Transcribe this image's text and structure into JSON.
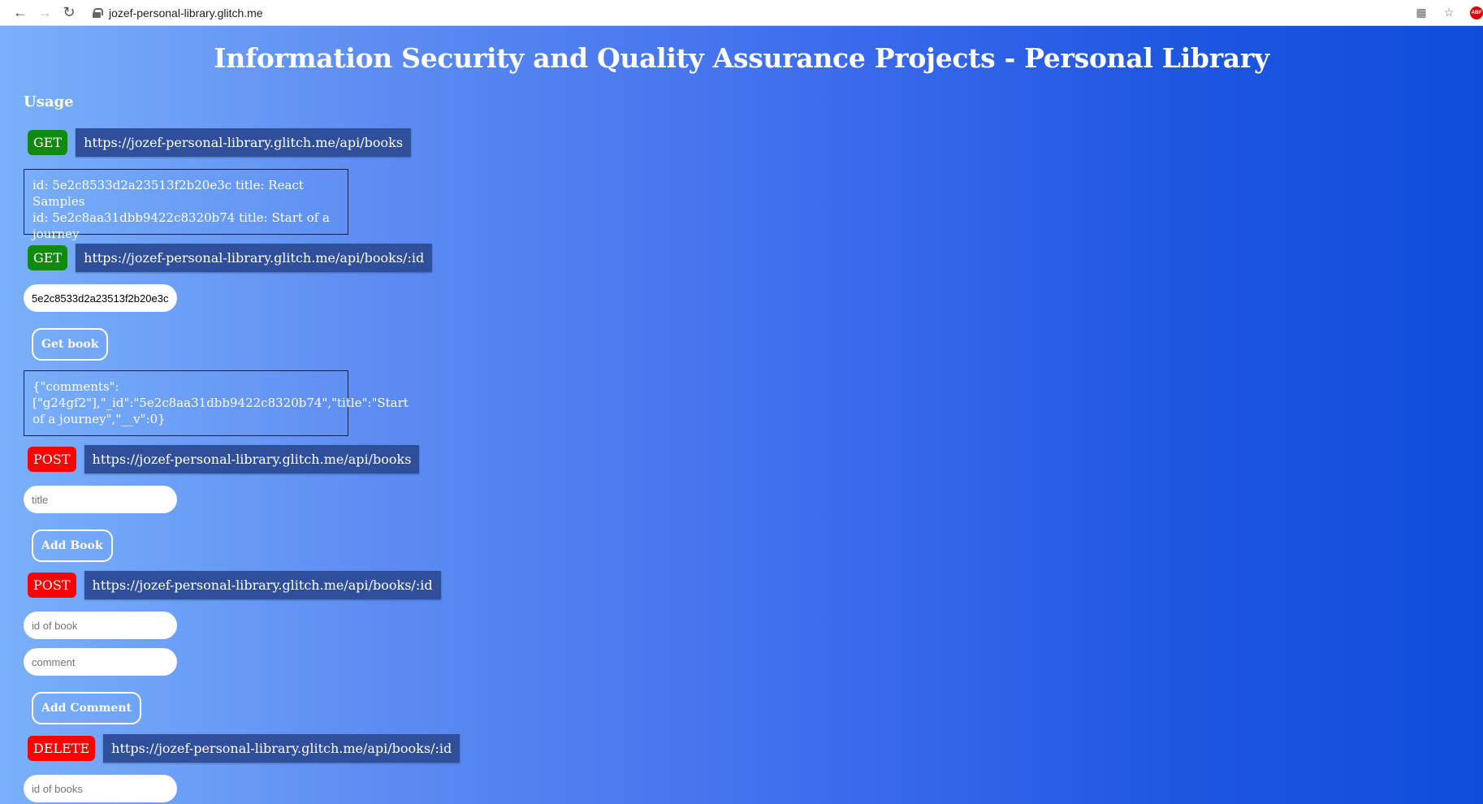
{
  "browser": {
    "url": "jozef-personal-library.glitch.me",
    "extension_badge": "ABP"
  },
  "page": {
    "title": "Information Security and Quality Assurance Projects - Personal Library",
    "usage_heading": "Usage"
  },
  "endpoints": {
    "get_books": {
      "method": "GET",
      "url": "https://jozef-personal-library.glitch.me/api/books"
    },
    "get_book": {
      "method": "GET",
      "url": "https://jozef-personal-library.glitch.me/api/books/:id"
    },
    "post_book": {
      "method": "POST",
      "url": "https://jozef-personal-library.glitch.me/api/books"
    },
    "post_comment": {
      "method": "POST",
      "url": "https://jozef-personal-library.glitch.me/api/books/:id"
    },
    "delete_book": {
      "method": "DELETE",
      "url": "https://jozef-personal-library.glitch.me/api/books/:id"
    }
  },
  "books_output": {
    "line1": "id: 5e2c8533d2a23513f2b20e3c title: React Samples",
    "line2": "id: 5e2c8aa31dbb9422c8320b74 title: Start of a journey"
  },
  "get_book_form": {
    "id_value": "5e2c8533d2a23513f2b20e3c",
    "button_label": "Get book",
    "output": "{\"comments\":[\"g24gf2\"],\"_id\":\"5e2c8aa31dbb9422c8320b74\",\"title\":\"Start of a journey\",\"__v\":0}"
  },
  "add_book_form": {
    "title_placeholder": "title",
    "button_label": "Add Book"
  },
  "add_comment_form": {
    "id_placeholder": "id of book",
    "comment_placeholder": "comment",
    "button_label": "Add Comment"
  },
  "delete_form": {
    "id_placeholder": "id of books"
  }
}
